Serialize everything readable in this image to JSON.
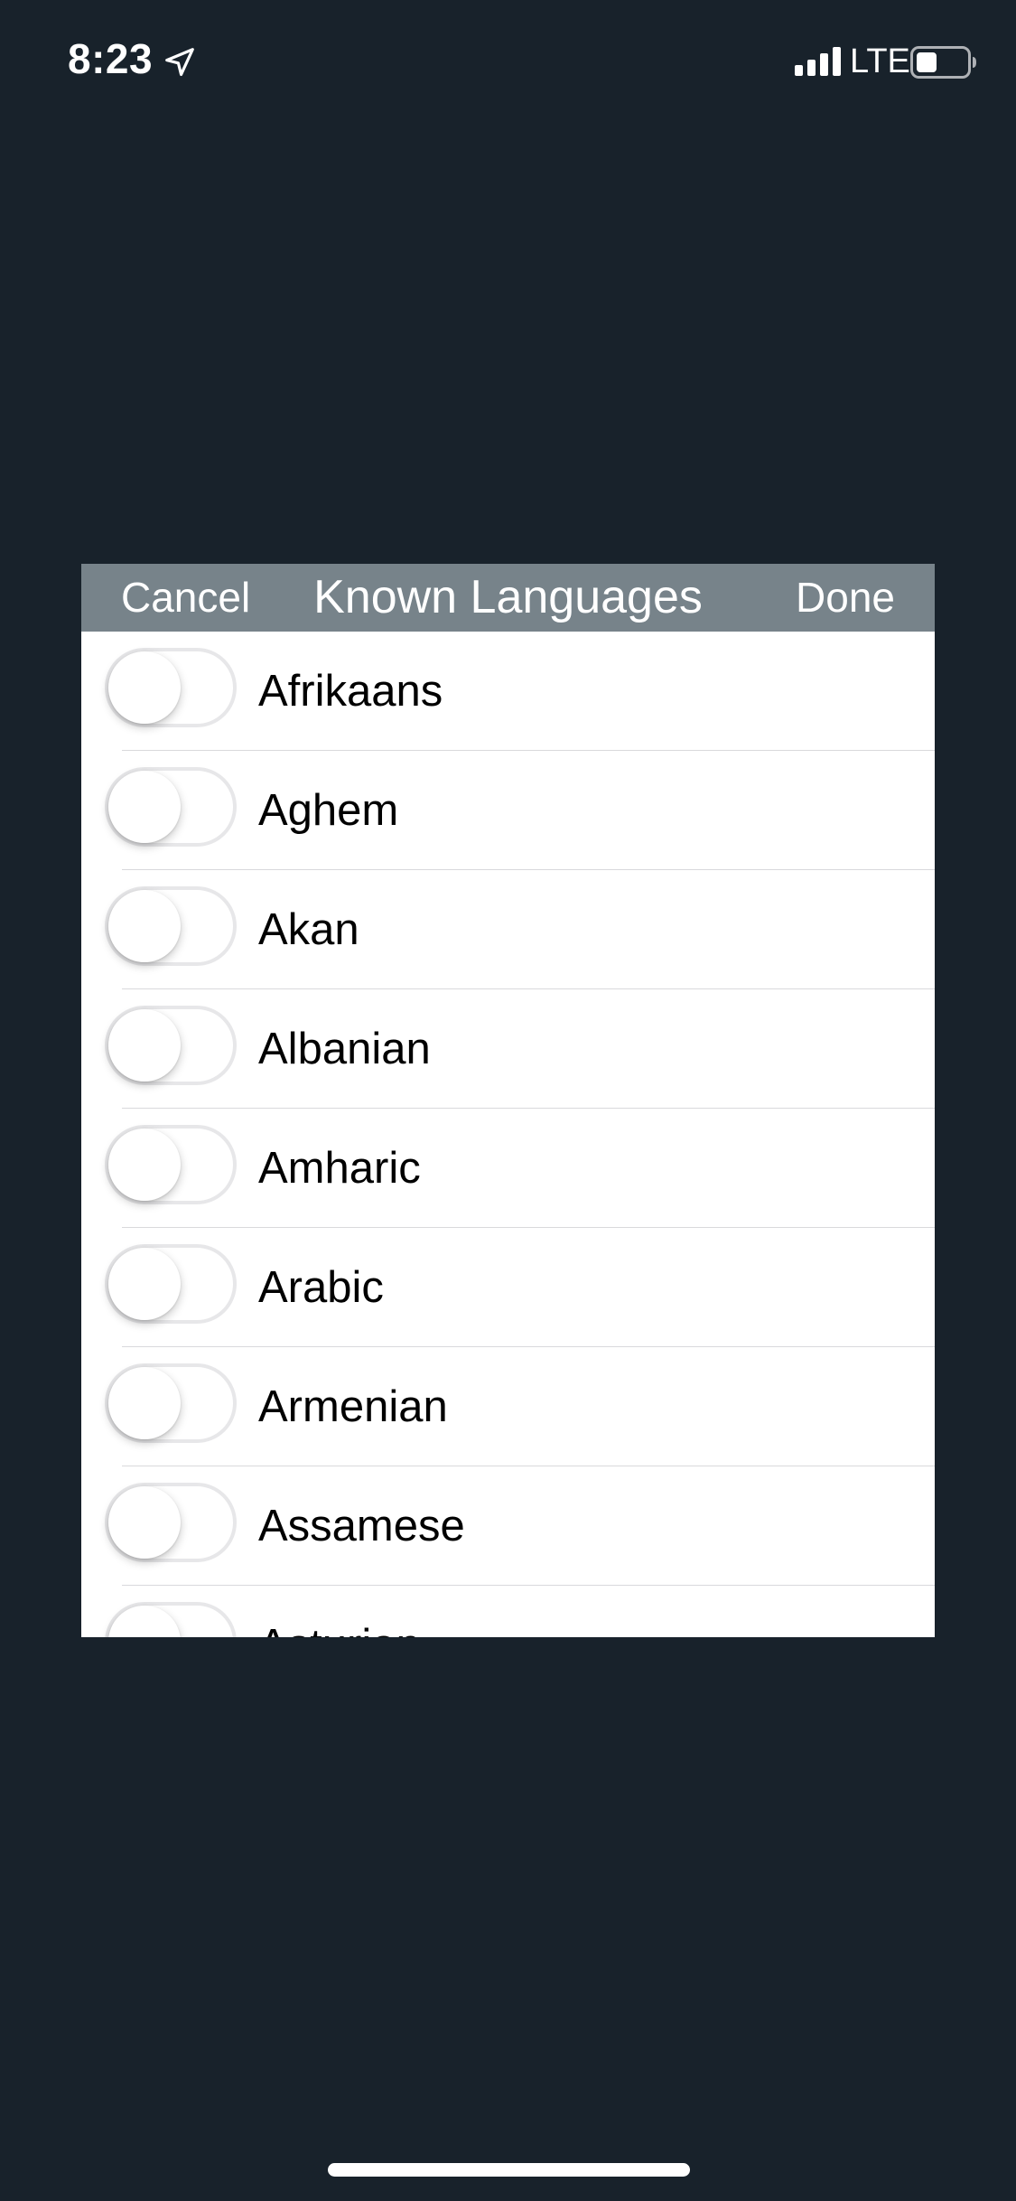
{
  "status_bar": {
    "time": "8:23",
    "network": "LTE",
    "icons": [
      "location-arrow-icon",
      "cellular-signal-icon",
      "battery-icon"
    ]
  },
  "dialog": {
    "cancel_label": "Cancel",
    "title": "Known Languages",
    "done_label": "Done"
  },
  "languages": [
    {
      "label": "Afrikaans",
      "enabled": false
    },
    {
      "label": "Aghem",
      "enabled": false
    },
    {
      "label": "Akan",
      "enabled": false
    },
    {
      "label": "Albanian",
      "enabled": false
    },
    {
      "label": "Amharic",
      "enabled": false
    },
    {
      "label": "Arabic",
      "enabled": false
    },
    {
      "label": "Armenian",
      "enabled": false
    },
    {
      "label": "Assamese",
      "enabled": false
    },
    {
      "label": "Asturian",
      "enabled": false
    }
  ],
  "colors": {
    "background": "#18222b",
    "header": "#77838a",
    "toggle_border": "#e7e7e9",
    "separator": "#d9d9dc"
  }
}
